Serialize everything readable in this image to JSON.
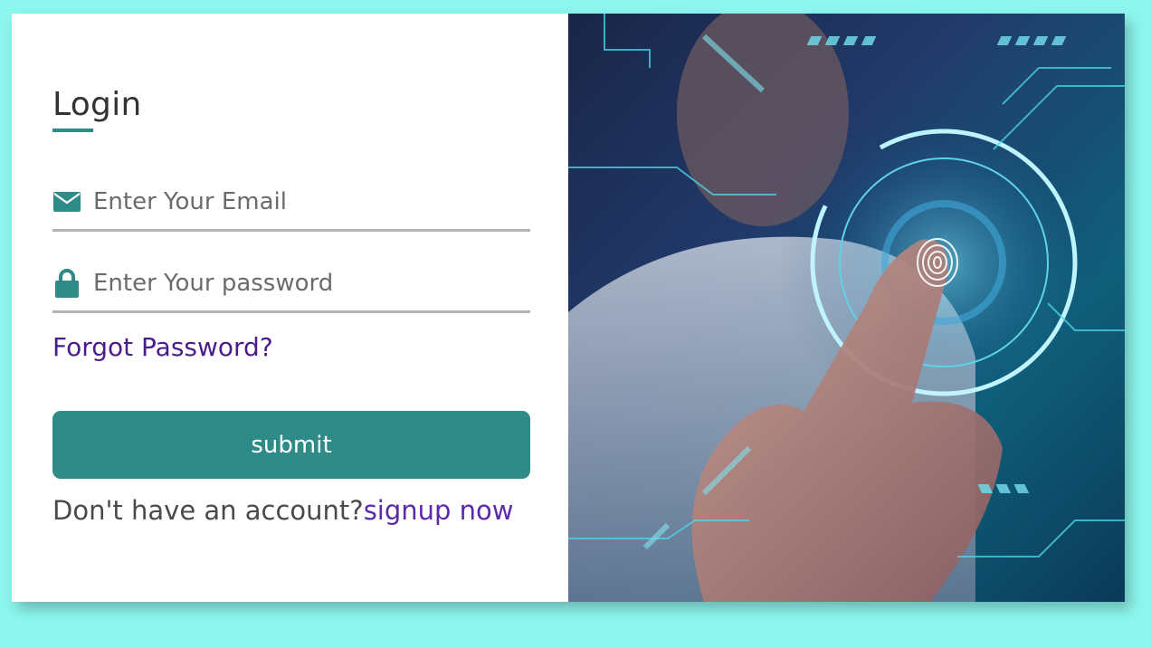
{
  "login": {
    "title": "Login",
    "email": {
      "placeholder": "Enter Your Email",
      "value": ""
    },
    "password": {
      "placeholder": "Enter Your password",
      "value": ""
    },
    "forgot_label": "Forgot Password?",
    "submit_label": "submit",
    "no_account_text": "Don't have an account?",
    "signup_label": "signup now"
  },
  "icons": {
    "email": "envelope-icon",
    "password": "lock-icon"
  },
  "colors": {
    "page_background": "#8df7ef",
    "accent": "#2e8b87",
    "link": "#4a1d8a",
    "signup_link": "#5b2aa6"
  }
}
